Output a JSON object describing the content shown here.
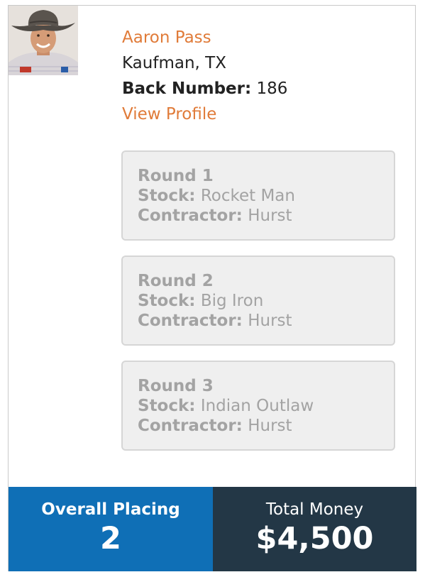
{
  "rider": {
    "name": "Aaron Pass",
    "hometown": "Kaufman, TX",
    "back_number_label": "Back Number:",
    "back_number": "186",
    "profile_link": "View Profile",
    "avatar_icon": "cowboy-portrait-icon"
  },
  "rounds": [
    {
      "title": "Round 1",
      "stock_label": "Stock:",
      "stock": "Rocket Man",
      "contractor_label": "Contractor:",
      "contractor": "Hurst"
    },
    {
      "title": "Round 2",
      "stock_label": "Stock:",
      "stock": "Big Iron",
      "contractor_label": "Contractor:",
      "contractor": "Hurst"
    },
    {
      "title": "Round 3",
      "stock_label": "Stock:",
      "stock": "Indian Outlaw",
      "contractor_label": "Contractor:",
      "contractor": "Hurst"
    }
  ],
  "summary": {
    "placing_label": "Overall Placing",
    "placing": "2",
    "money_label": "Total Money",
    "money": "$4,500"
  },
  "colors": {
    "accent": "#e07b39",
    "placing_bg": "#0f6fb6",
    "money_bg": "#233746",
    "round_text": "#a3a3a3"
  }
}
